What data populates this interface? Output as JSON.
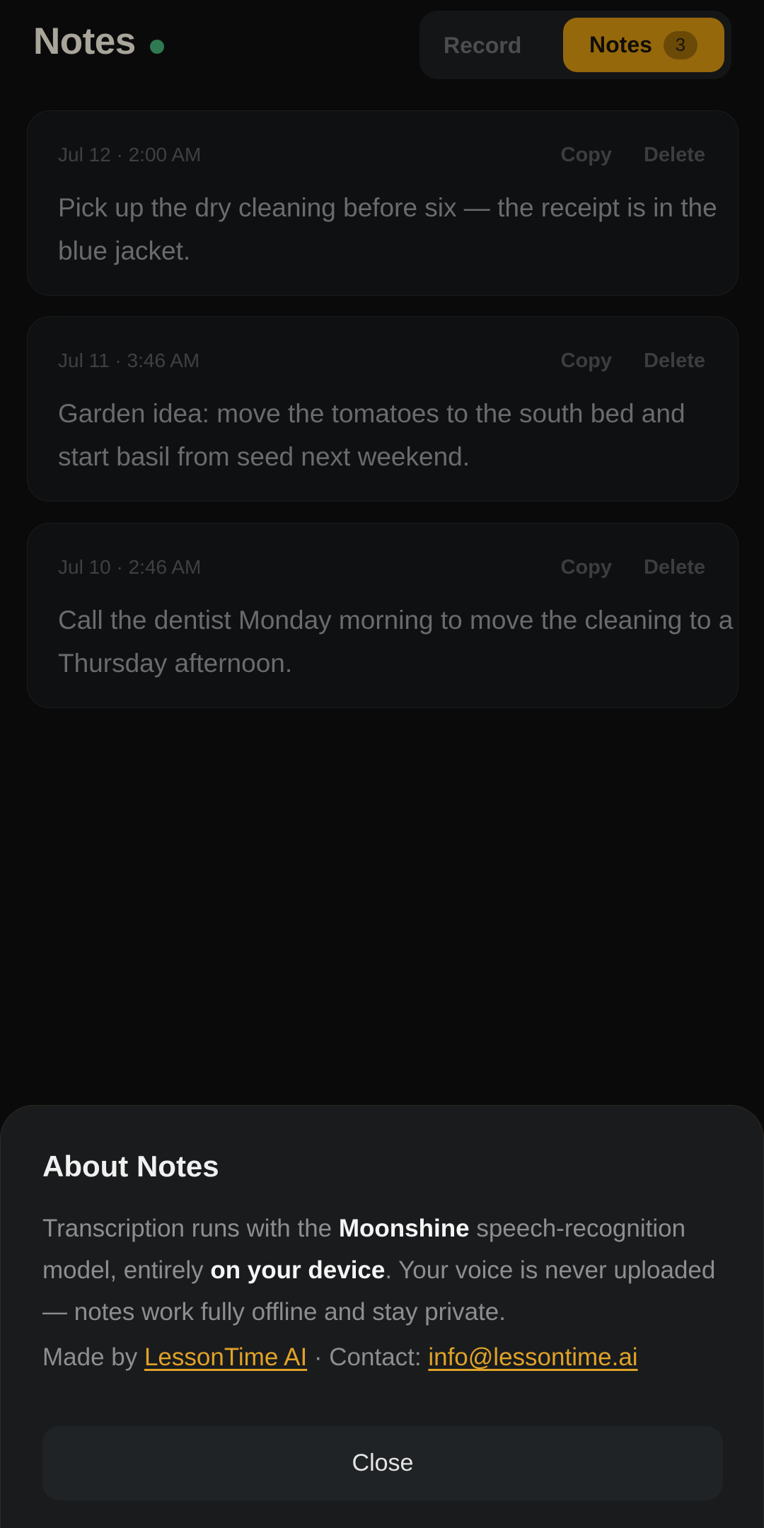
{
  "header": {
    "title": "Notes",
    "status_color": "#2f7a52",
    "tabs": {
      "record_label": "Record",
      "notes_label": "Notes",
      "notes_count": "3"
    }
  },
  "notes": [
    {
      "date": "Jul 12 · 2:00 AM",
      "copy_label": "Copy",
      "delete_label": "Delete",
      "text": "Pick up the dry cleaning before six — the receipt is in the blue jacket."
    },
    {
      "date": "Jul 11 · 3:46 AM",
      "copy_label": "Copy",
      "delete_label": "Delete",
      "text": "Garden idea: move the tomatoes to the south bed and start basil from seed next weekend."
    },
    {
      "date": "Jul 10 · 2:46 AM",
      "copy_label": "Copy",
      "delete_label": "Delete",
      "text": "Call the dentist Monday morning to move the cleaning to a Thursday afternoon."
    }
  ],
  "about": {
    "title": "About Notes",
    "body_1": "Transcription runs with the ",
    "model_name": "Moonshine",
    "body_2": " speech-recognition model, entirely ",
    "on_device": "on your device",
    "body_3": ". Your voice is never uploaded — notes work fully offline and stay private.",
    "made_by_prefix": "Made by ",
    "company_link": "LessonTime AI",
    "contact_prefix": " · Contact: ",
    "email_link": "info@lessontime.ai",
    "close_label": "Close",
    "accent_color": "#e0a228"
  }
}
